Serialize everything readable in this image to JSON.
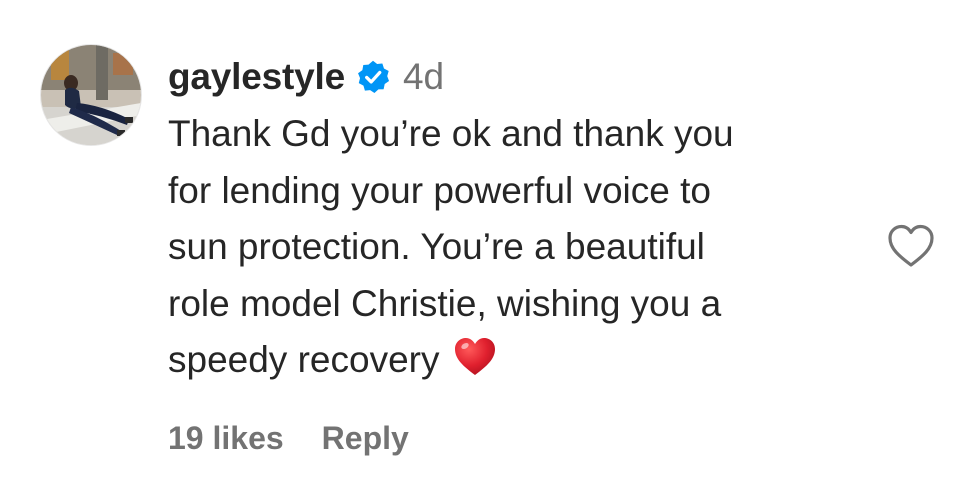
{
  "comment": {
    "username": "gaylestyle",
    "verified": true,
    "timestamp": "4d",
    "text_lines": [
      "Thank Gd you’re ok and thank you",
      "for lending your powerful voice to",
      "sun protection. You’re a beautiful",
      "role model Christie, wishing you a",
      "speedy recovery"
    ],
    "emoji": "red-heart",
    "likes_label": "19 likes",
    "reply_label": "Reply"
  },
  "icons": {
    "verified_badge": "verified-badge-icon",
    "like": "heart-outline-icon",
    "emoji": "red-heart-emoji-icon"
  },
  "colors": {
    "verified_blue": "#0095f6",
    "text_primary": "#262626",
    "text_secondary": "#737373",
    "heart_red": "#e0202e",
    "icon_outline": "#737373"
  }
}
